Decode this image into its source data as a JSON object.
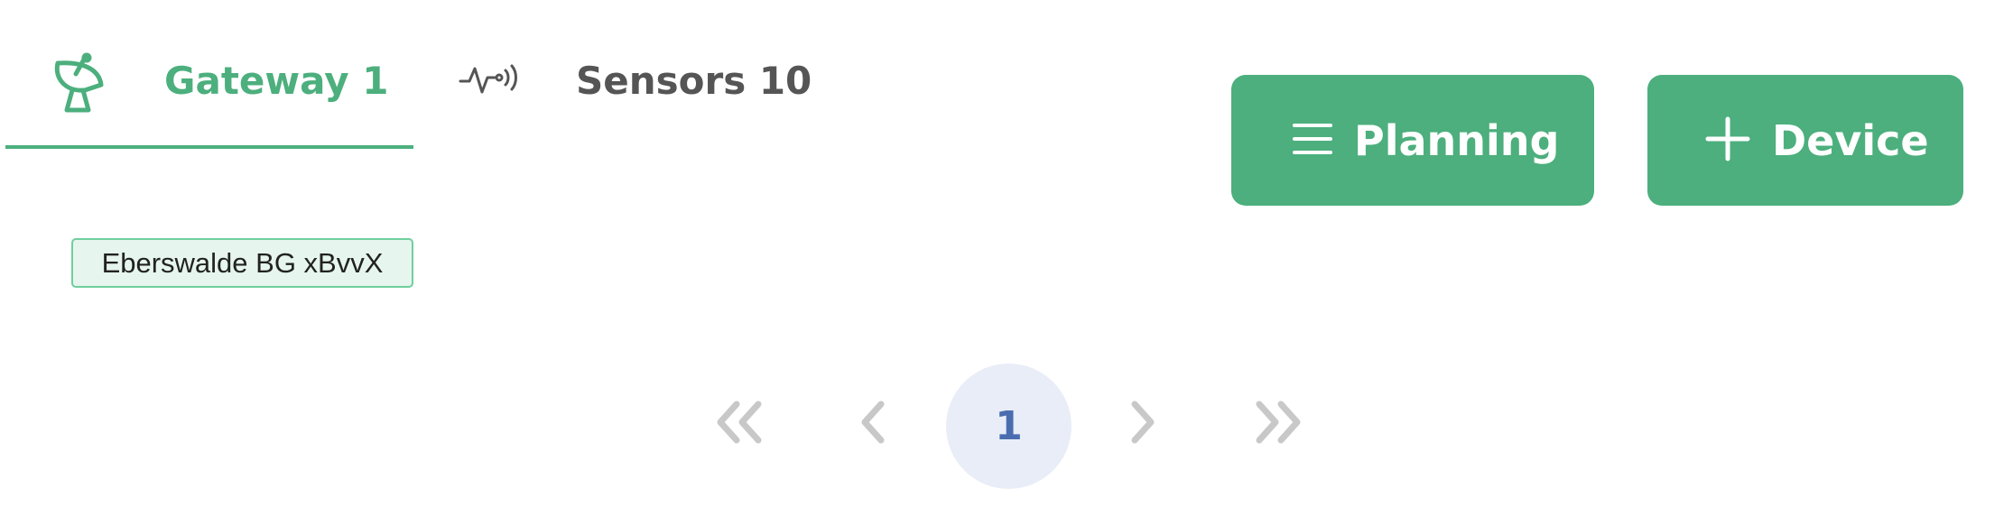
{
  "tabs": [
    {
      "label": "Gateway 1",
      "icon": "satellite-dish-icon",
      "active": true
    },
    {
      "label": "Sensors 10",
      "icon": "sensor-signal-icon",
      "active": false
    }
  ],
  "actions": {
    "planning_label": "Planning",
    "planning_icon": "menu-icon",
    "device_label": "Device",
    "device_icon": "plus-icon"
  },
  "tag": {
    "label": "Eberswalde BG xBvvX"
  },
  "pagination": {
    "current_page": "1",
    "first_icon": "double-chevron-left-icon",
    "prev_icon": "chevron-left-icon",
    "next_icon": "chevron-right-icon",
    "last_icon": "double-chevron-right-icon"
  },
  "colors": {
    "accent": "#4caf7d",
    "tag_background": "#e6f6ee",
    "tag_border": "#6fcf9d",
    "pager_disabled": "#c8c8c8",
    "pager_current_bg": "#e8edf7",
    "pager_current_text": "#4a6db0"
  }
}
